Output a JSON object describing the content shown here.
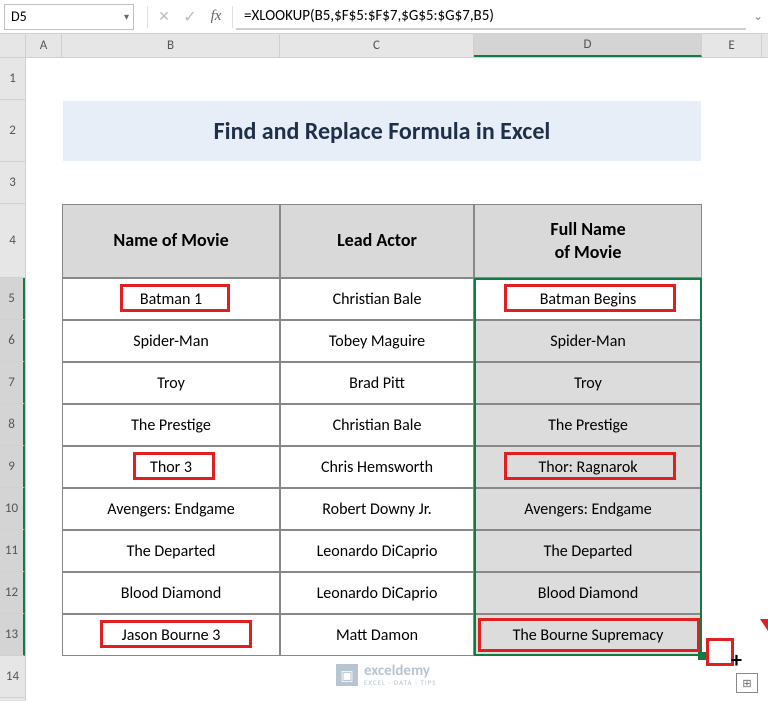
{
  "nameBox": "D5",
  "formula": "=XLOOKUP(B5,$F$5:$F$7,$G$5:$G$7,B5)",
  "title": "Find and Replace Formula in Excel",
  "colHeaders": {
    "a": "A",
    "b": "B",
    "c": "C",
    "d": "D",
    "e": "E"
  },
  "rowHeaders": [
    "1",
    "2",
    "3",
    "4",
    "5",
    "6",
    "7",
    "8",
    "9",
    "10",
    "11",
    "12",
    "13",
    "14"
  ],
  "tableHeaders": {
    "b": "Name of Movie",
    "c": "Lead Actor",
    "d1": "Full Name",
    "d2": "of Movie"
  },
  "rows": [
    {
      "b": "Batman 1",
      "c": "Christian Bale",
      "d": "Batman Begins"
    },
    {
      "b": "Spider-Man",
      "c": "Tobey Maguire",
      "d": "Spider-Man"
    },
    {
      "b": "Troy",
      "c": "Brad Pitt",
      "d": "Troy"
    },
    {
      "b": "The Prestige",
      "c": "Christian Bale",
      "d": "The Prestige"
    },
    {
      "b": "Thor 3",
      "c": "Chris Hemsworth",
      "d": "Thor: Ragnarok"
    },
    {
      "b": "Avengers: Endgame",
      "c": "Robert Downy Jr.",
      "d": "Avengers: Endgame"
    },
    {
      "b": "The Departed",
      "c": "Leonardo DiCaprio",
      "d": "The Departed"
    },
    {
      "b": "Blood Diamond",
      "c": "Leonardo DiCaprio",
      "d": "Blood Diamond"
    },
    {
      "b": "Jason Bourne 3",
      "c": "Matt Damon",
      "d": "The Bourne Supremacy"
    }
  ],
  "watermark": {
    "main": "exceldemy",
    "sub": "EXCEL · DATA · TIPS"
  }
}
